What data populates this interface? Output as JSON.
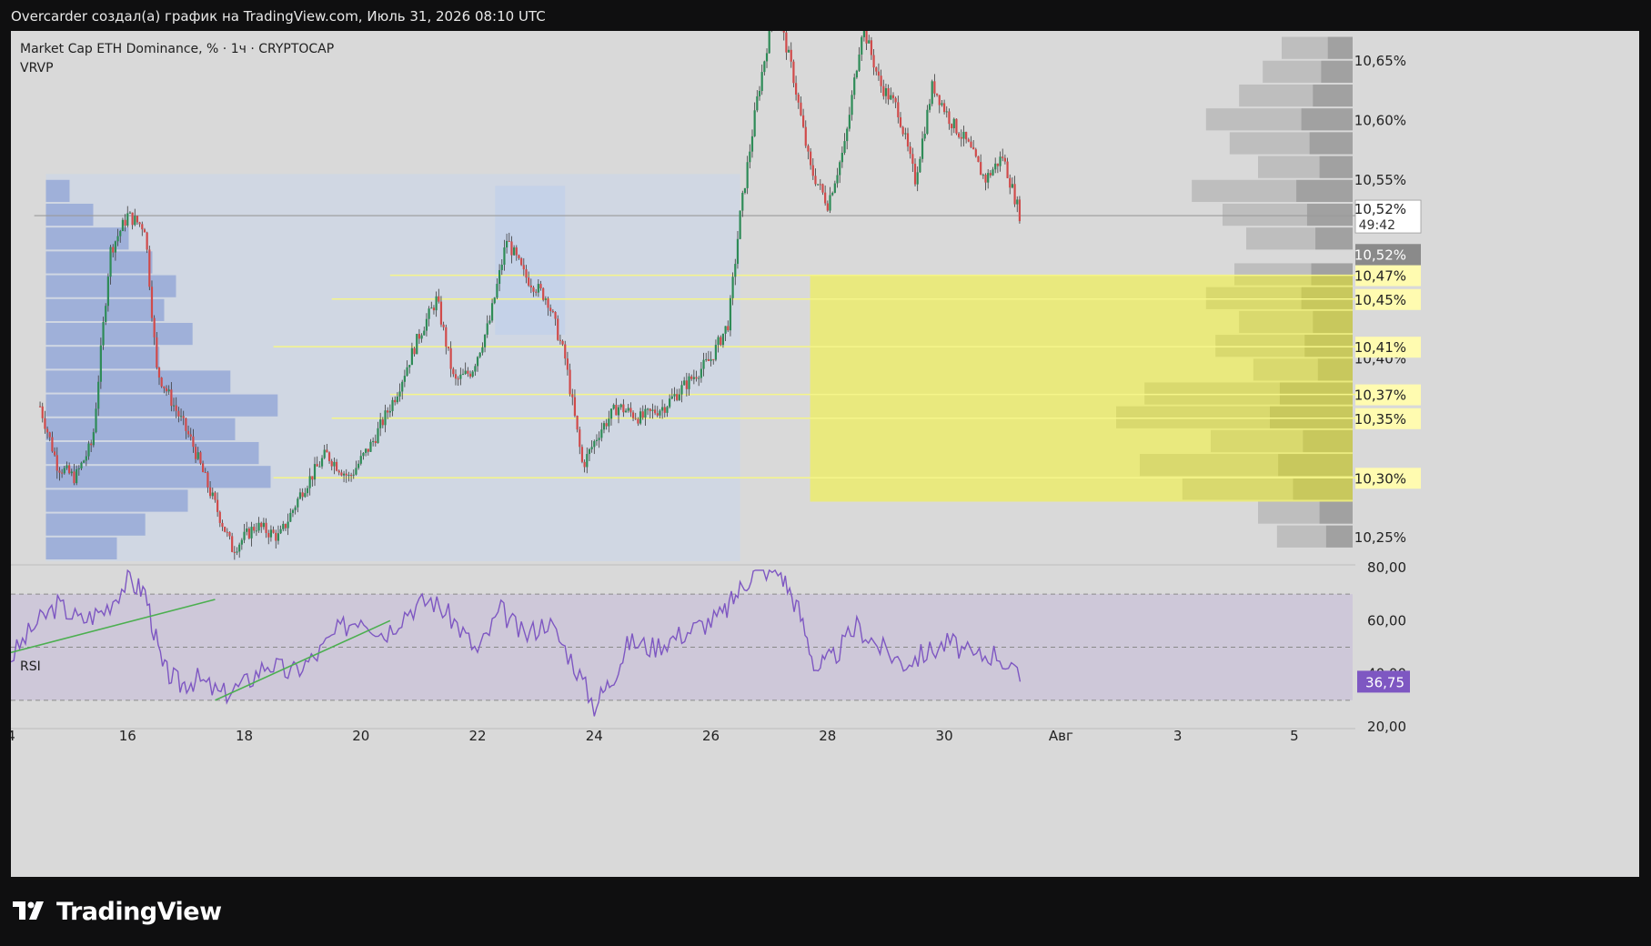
{
  "header": {
    "caption": "Overcarder создал(а) график на TradingView.com, Июль 31, 2026 08:10 UTC"
  },
  "legend": {
    "symbol_line": "Market Cap ETH Dominance, % · 1ч · CRYPTOCAP",
    "indicator": "VRVP"
  },
  "rsi": {
    "label": "RSI",
    "value_label": "36,75",
    "levels": [
      70,
      50,
      30
    ],
    "axis_ticks": [
      "80,00",
      "60,00",
      "40,00",
      "20,00"
    ]
  },
  "brand": {
    "name": "TradingView"
  },
  "colors": {
    "up": "#2e8b57",
    "down": "#d04a4a",
    "rsi_line": "#7e57c2",
    "zone": "#ffff00",
    "trendline": "#4caf50",
    "vrvp": "#8fa3d6"
  },
  "chart_data": {
    "type": "candlestick",
    "y_unit": "%",
    "ylim": [
      10.23,
      10.675
    ],
    "price_axis_ticks": [
      "10,65%",
      "10,60%",
      "10,55%",
      "10,40%",
      "10,25%"
    ],
    "price_labels": [
      {
        "text": "10,52%",
        "sub": "49:42",
        "value": 10.52,
        "kind": "current"
      },
      {
        "text": "10,52%",
        "value": 10.5,
        "kind": "prev"
      },
      {
        "text": "10,47%",
        "value": 10.47,
        "kind": "level"
      },
      {
        "text": "10,45%",
        "value": 10.45,
        "kind": "level"
      },
      {
        "text": "10,41%",
        "value": 10.41,
        "kind": "level"
      },
      {
        "text": "10,37%",
        "value": 10.37,
        "kind": "level"
      },
      {
        "text": "10,35%",
        "value": 10.35,
        "kind": "level"
      },
      {
        "text": "10,30%",
        "value": 10.3,
        "kind": "level"
      }
    ],
    "x_axis_ticks": [
      "4",
      "16",
      "18",
      "20",
      "22",
      "24",
      "26",
      "28",
      "30",
      "Авг",
      "3",
      "5"
    ],
    "x_tick_days": [
      14,
      16,
      18,
      20,
      22,
      24,
      26,
      28,
      30,
      32,
      34,
      36
    ],
    "xlim_days": [
      14.0,
      37.0
    ],
    "last_bar_day": 31.3,
    "current_price": 10.52,
    "highlight_zone": {
      "x_from_day": 27.7,
      "y_from": 10.28,
      "y_to": 10.47
    },
    "horizontal_levels": [
      10.47,
      10.45,
      10.41,
      10.37,
      10.35,
      10.3
    ],
    "price_path": [
      [
        14.5,
        10.36
      ],
      [
        14.8,
        10.31
      ],
      [
        15.1,
        10.3
      ],
      [
        15.4,
        10.33
      ],
      [
        15.7,
        10.49
      ],
      [
        16.0,
        10.52
      ],
      [
        16.3,
        10.51
      ],
      [
        16.5,
        10.39
      ],
      [
        16.8,
        10.36
      ],
      [
        17.1,
        10.33
      ],
      [
        17.4,
        10.29
      ],
      [
        17.8,
        10.24
      ],
      [
        18.2,
        10.26
      ],
      [
        18.6,
        10.25
      ],
      [
        19.0,
        10.29
      ],
      [
        19.4,
        10.32
      ],
      [
        19.8,
        10.3
      ],
      [
        20.2,
        10.33
      ],
      [
        20.6,
        10.37
      ],
      [
        21.0,
        10.42
      ],
      [
        21.3,
        10.45
      ],
      [
        21.6,
        10.38
      ],
      [
        21.9,
        10.39
      ],
      [
        22.2,
        10.43
      ],
      [
        22.5,
        10.5
      ],
      [
        22.8,
        10.47
      ],
      [
        23.2,
        10.45
      ],
      [
        23.5,
        10.4
      ],
      [
        23.8,
        10.31
      ],
      [
        24.1,
        10.34
      ],
      [
        24.4,
        10.36
      ],
      [
        24.8,
        10.35
      ],
      [
        25.2,
        10.36
      ],
      [
        25.6,
        10.38
      ],
      [
        26.0,
        10.4
      ],
      [
        26.3,
        10.43
      ],
      [
        26.5,
        10.52
      ],
      [
        26.8,
        10.62
      ],
      [
        27.1,
        10.7
      ],
      [
        27.4,
        10.64
      ],
      [
        27.7,
        10.56
      ],
      [
        28.0,
        10.53
      ],
      [
        28.3,
        10.58
      ],
      [
        28.6,
        10.68
      ],
      [
        28.9,
        10.63
      ],
      [
        29.2,
        10.61
      ],
      [
        29.5,
        10.55
      ],
      [
        29.8,
        10.63
      ],
      [
        30.1,
        10.6
      ],
      [
        30.4,
        10.58
      ],
      [
        30.7,
        10.55
      ],
      [
        31.0,
        10.57
      ],
      [
        31.3,
        10.52
      ]
    ],
    "rsi_path": [
      [
        14.0,
        46
      ],
      [
        14.4,
        58
      ],
      [
        14.8,
        66
      ],
      [
        15.2,
        60
      ],
      [
        15.6,
        64
      ],
      [
        16.0,
        75
      ],
      [
        16.3,
        71
      ],
      [
        16.6,
        42
      ],
      [
        16.9,
        36
      ],
      [
        17.2,
        38
      ],
      [
        17.6,
        32
      ],
      [
        18.0,
        36
      ],
      [
        18.4,
        44
      ],
      [
        18.8,
        40
      ],
      [
        19.2,
        46
      ],
      [
        19.6,
        56
      ],
      [
        20.0,
        62
      ],
      [
        20.4,
        55
      ],
      [
        20.8,
        64
      ],
      [
        21.2,
        68
      ],
      [
        21.6,
        60
      ],
      [
        22.0,
        48
      ],
      [
        22.4,
        64
      ],
      [
        22.8,
        54
      ],
      [
        23.2,
        60
      ],
      [
        23.6,
        46
      ],
      [
        24.0,
        28
      ],
      [
        24.3,
        38
      ],
      [
        24.6,
        52
      ],
      [
        25.0,
        50
      ],
      [
        25.4,
        54
      ],
      [
        25.8,
        58
      ],
      [
        26.2,
        62
      ],
      [
        26.5,
        72
      ],
      [
        26.8,
        80
      ],
      [
        27.2,
        78
      ],
      [
        27.5,
        64
      ],
      [
        27.8,
        42
      ],
      [
        28.1,
        46
      ],
      [
        28.5,
        58
      ],
      [
        28.9,
        50
      ],
      [
        29.3,
        44
      ],
      [
        29.7,
        48
      ],
      [
        30.1,
        52
      ],
      [
        30.5,
        46
      ],
      [
        30.9,
        48
      ],
      [
        31.3,
        37
      ]
    ],
    "trendlines": [
      {
        "pane": "rsi",
        "from": [
          14.0,
          48
        ],
        "to": [
          17.5,
          68
        ]
      },
      {
        "pane": "rsi",
        "from": [
          17.5,
          30
        ],
        "to": [
          20.5,
          60
        ]
      }
    ],
    "volume_profile_left": [
      {
        "price": 10.54,
        "vol": 0.1
      },
      {
        "price": 10.52,
        "vol": 0.2
      },
      {
        "price": 10.5,
        "vol": 0.35
      },
      {
        "price": 10.48,
        "vol": 0.45
      },
      {
        "price": 10.46,
        "vol": 0.55
      },
      {
        "price": 10.44,
        "vol": 0.5
      },
      {
        "price": 10.42,
        "vol": 0.62
      },
      {
        "price": 10.4,
        "vol": 0.48
      },
      {
        "price": 10.38,
        "vol": 0.78
      },
      {
        "price": 10.36,
        "vol": 0.98
      },
      {
        "price": 10.34,
        "vol": 0.8
      },
      {
        "price": 10.32,
        "vol": 0.9
      },
      {
        "price": 10.3,
        "vol": 0.95
      },
      {
        "price": 10.28,
        "vol": 0.6
      },
      {
        "price": 10.26,
        "vol": 0.42
      },
      {
        "price": 10.24,
        "vol": 0.3
      }
    ],
    "volume_profile_right": [
      {
        "price": 10.66,
        "vol": 0.3
      },
      {
        "price": 10.64,
        "vol": 0.38
      },
      {
        "price": 10.62,
        "vol": 0.48
      },
      {
        "price": 10.6,
        "vol": 0.62
      },
      {
        "price": 10.58,
        "vol": 0.52
      },
      {
        "price": 10.56,
        "vol": 0.4
      },
      {
        "price": 10.54,
        "vol": 0.68
      },
      {
        "price": 10.52,
        "vol": 0.55
      },
      {
        "price": 10.5,
        "vol": 0.45
      },
      {
        "price": 10.47,
        "vol": 0.5
      },
      {
        "price": 10.45,
        "vol": 0.62
      },
      {
        "price": 10.43,
        "vol": 0.48
      },
      {
        "price": 10.41,
        "vol": 0.58
      },
      {
        "price": 10.39,
        "vol": 0.42
      },
      {
        "price": 10.37,
        "vol": 0.88
      },
      {
        "price": 10.35,
        "vol": 1.0
      },
      {
        "price": 10.33,
        "vol": 0.6
      },
      {
        "price": 10.31,
        "vol": 0.9
      },
      {
        "price": 10.29,
        "vol": 0.72
      },
      {
        "price": 10.27,
        "vol": 0.4
      },
      {
        "price": 10.25,
        "vol": 0.32
      }
    ]
  }
}
